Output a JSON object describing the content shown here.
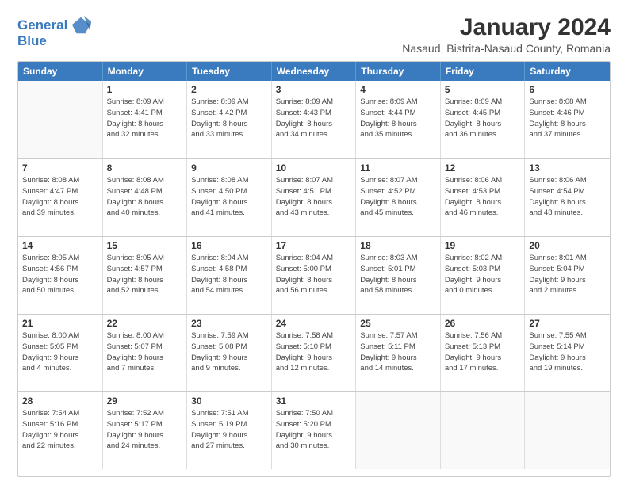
{
  "header": {
    "logo_line1": "General",
    "logo_line2": "Blue",
    "month": "January 2024",
    "location": "Nasaud, Bistrita-Nasaud County, Romania"
  },
  "weekdays": [
    "Sunday",
    "Monday",
    "Tuesday",
    "Wednesday",
    "Thursday",
    "Friday",
    "Saturday"
  ],
  "weeks": [
    [
      {
        "day": "",
        "info": ""
      },
      {
        "day": "1",
        "info": "Sunrise: 8:09 AM\nSunset: 4:41 PM\nDaylight: 8 hours\nand 32 minutes."
      },
      {
        "day": "2",
        "info": "Sunrise: 8:09 AM\nSunset: 4:42 PM\nDaylight: 8 hours\nand 33 minutes."
      },
      {
        "day": "3",
        "info": "Sunrise: 8:09 AM\nSunset: 4:43 PM\nDaylight: 8 hours\nand 34 minutes."
      },
      {
        "day": "4",
        "info": "Sunrise: 8:09 AM\nSunset: 4:44 PM\nDaylight: 8 hours\nand 35 minutes."
      },
      {
        "day": "5",
        "info": "Sunrise: 8:09 AM\nSunset: 4:45 PM\nDaylight: 8 hours\nand 36 minutes."
      },
      {
        "day": "6",
        "info": "Sunrise: 8:08 AM\nSunset: 4:46 PM\nDaylight: 8 hours\nand 37 minutes."
      }
    ],
    [
      {
        "day": "7",
        "info": "Sunrise: 8:08 AM\nSunset: 4:47 PM\nDaylight: 8 hours\nand 39 minutes."
      },
      {
        "day": "8",
        "info": "Sunrise: 8:08 AM\nSunset: 4:48 PM\nDaylight: 8 hours\nand 40 minutes."
      },
      {
        "day": "9",
        "info": "Sunrise: 8:08 AM\nSunset: 4:50 PM\nDaylight: 8 hours\nand 41 minutes."
      },
      {
        "day": "10",
        "info": "Sunrise: 8:07 AM\nSunset: 4:51 PM\nDaylight: 8 hours\nand 43 minutes."
      },
      {
        "day": "11",
        "info": "Sunrise: 8:07 AM\nSunset: 4:52 PM\nDaylight: 8 hours\nand 45 minutes."
      },
      {
        "day": "12",
        "info": "Sunrise: 8:06 AM\nSunset: 4:53 PM\nDaylight: 8 hours\nand 46 minutes."
      },
      {
        "day": "13",
        "info": "Sunrise: 8:06 AM\nSunset: 4:54 PM\nDaylight: 8 hours\nand 48 minutes."
      }
    ],
    [
      {
        "day": "14",
        "info": "Sunrise: 8:05 AM\nSunset: 4:56 PM\nDaylight: 8 hours\nand 50 minutes."
      },
      {
        "day": "15",
        "info": "Sunrise: 8:05 AM\nSunset: 4:57 PM\nDaylight: 8 hours\nand 52 minutes."
      },
      {
        "day": "16",
        "info": "Sunrise: 8:04 AM\nSunset: 4:58 PM\nDaylight: 8 hours\nand 54 minutes."
      },
      {
        "day": "17",
        "info": "Sunrise: 8:04 AM\nSunset: 5:00 PM\nDaylight: 8 hours\nand 56 minutes."
      },
      {
        "day": "18",
        "info": "Sunrise: 8:03 AM\nSunset: 5:01 PM\nDaylight: 8 hours\nand 58 minutes."
      },
      {
        "day": "19",
        "info": "Sunrise: 8:02 AM\nSunset: 5:03 PM\nDaylight: 9 hours\nand 0 minutes."
      },
      {
        "day": "20",
        "info": "Sunrise: 8:01 AM\nSunset: 5:04 PM\nDaylight: 9 hours\nand 2 minutes."
      }
    ],
    [
      {
        "day": "21",
        "info": "Sunrise: 8:00 AM\nSunset: 5:05 PM\nDaylight: 9 hours\nand 4 minutes."
      },
      {
        "day": "22",
        "info": "Sunrise: 8:00 AM\nSunset: 5:07 PM\nDaylight: 9 hours\nand 7 minutes."
      },
      {
        "day": "23",
        "info": "Sunrise: 7:59 AM\nSunset: 5:08 PM\nDaylight: 9 hours\nand 9 minutes."
      },
      {
        "day": "24",
        "info": "Sunrise: 7:58 AM\nSunset: 5:10 PM\nDaylight: 9 hours\nand 12 minutes."
      },
      {
        "day": "25",
        "info": "Sunrise: 7:57 AM\nSunset: 5:11 PM\nDaylight: 9 hours\nand 14 minutes."
      },
      {
        "day": "26",
        "info": "Sunrise: 7:56 AM\nSunset: 5:13 PM\nDaylight: 9 hours\nand 17 minutes."
      },
      {
        "day": "27",
        "info": "Sunrise: 7:55 AM\nSunset: 5:14 PM\nDaylight: 9 hours\nand 19 minutes."
      }
    ],
    [
      {
        "day": "28",
        "info": "Sunrise: 7:54 AM\nSunset: 5:16 PM\nDaylight: 9 hours\nand 22 minutes."
      },
      {
        "day": "29",
        "info": "Sunrise: 7:52 AM\nSunset: 5:17 PM\nDaylight: 9 hours\nand 24 minutes."
      },
      {
        "day": "30",
        "info": "Sunrise: 7:51 AM\nSunset: 5:19 PM\nDaylight: 9 hours\nand 27 minutes."
      },
      {
        "day": "31",
        "info": "Sunrise: 7:50 AM\nSunset: 5:20 PM\nDaylight: 9 hours\nand 30 minutes."
      },
      {
        "day": "",
        "info": ""
      },
      {
        "day": "",
        "info": ""
      },
      {
        "day": "",
        "info": ""
      }
    ]
  ]
}
